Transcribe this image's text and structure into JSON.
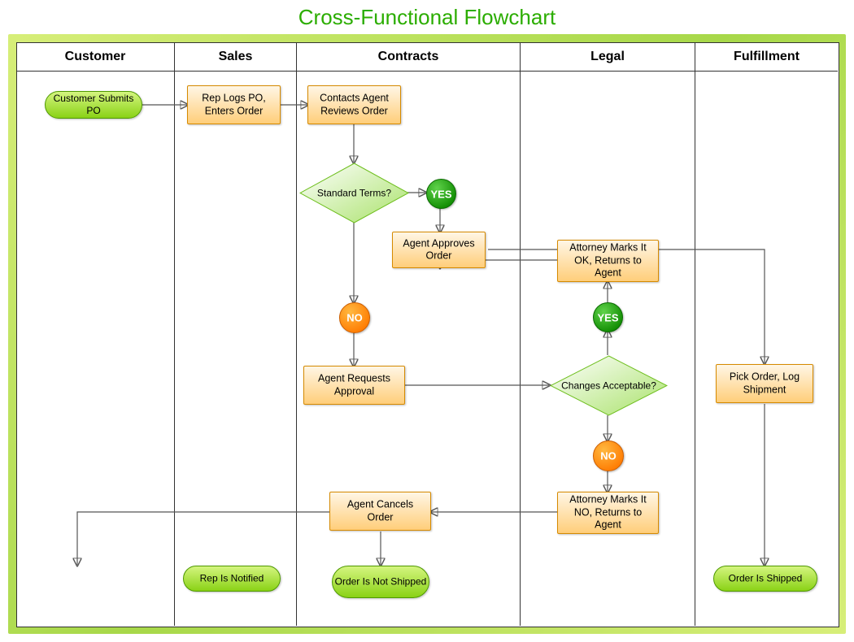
{
  "title": "Cross-Functional Flowchart",
  "lanes": {
    "customer": "Customer",
    "sales": "Sales",
    "contracts": "Contracts",
    "legal": "Legal",
    "fulfillment": "Fulfillment"
  },
  "nodes": {
    "customer_submits_po": "Customer Submits PO",
    "rep_logs_po": "Rep Logs PO, Enters Order",
    "contacts_agent": "Contacts Agent Reviews Order",
    "standard_terms": "Standard Terms?",
    "agent_approves": "Agent Approves Order",
    "agent_requests": "Agent Requests Approval",
    "changes_acceptable": "Changes Acceptable?",
    "attorney_ok": "Attorney Marks It OK, Returns to Agent",
    "attorney_no": "Attorney Marks It NO, Returns to Agent",
    "agent_cancels": "Agent Cancels Order",
    "rep_notified": "Rep Is Notified",
    "order_not_shipped": "Order Is Not Shipped",
    "pick_order": "Pick Order, Log Shipment",
    "order_shipped": "Order Is Shipped"
  },
  "badges": {
    "yes": "YES",
    "no": "NO"
  }
}
